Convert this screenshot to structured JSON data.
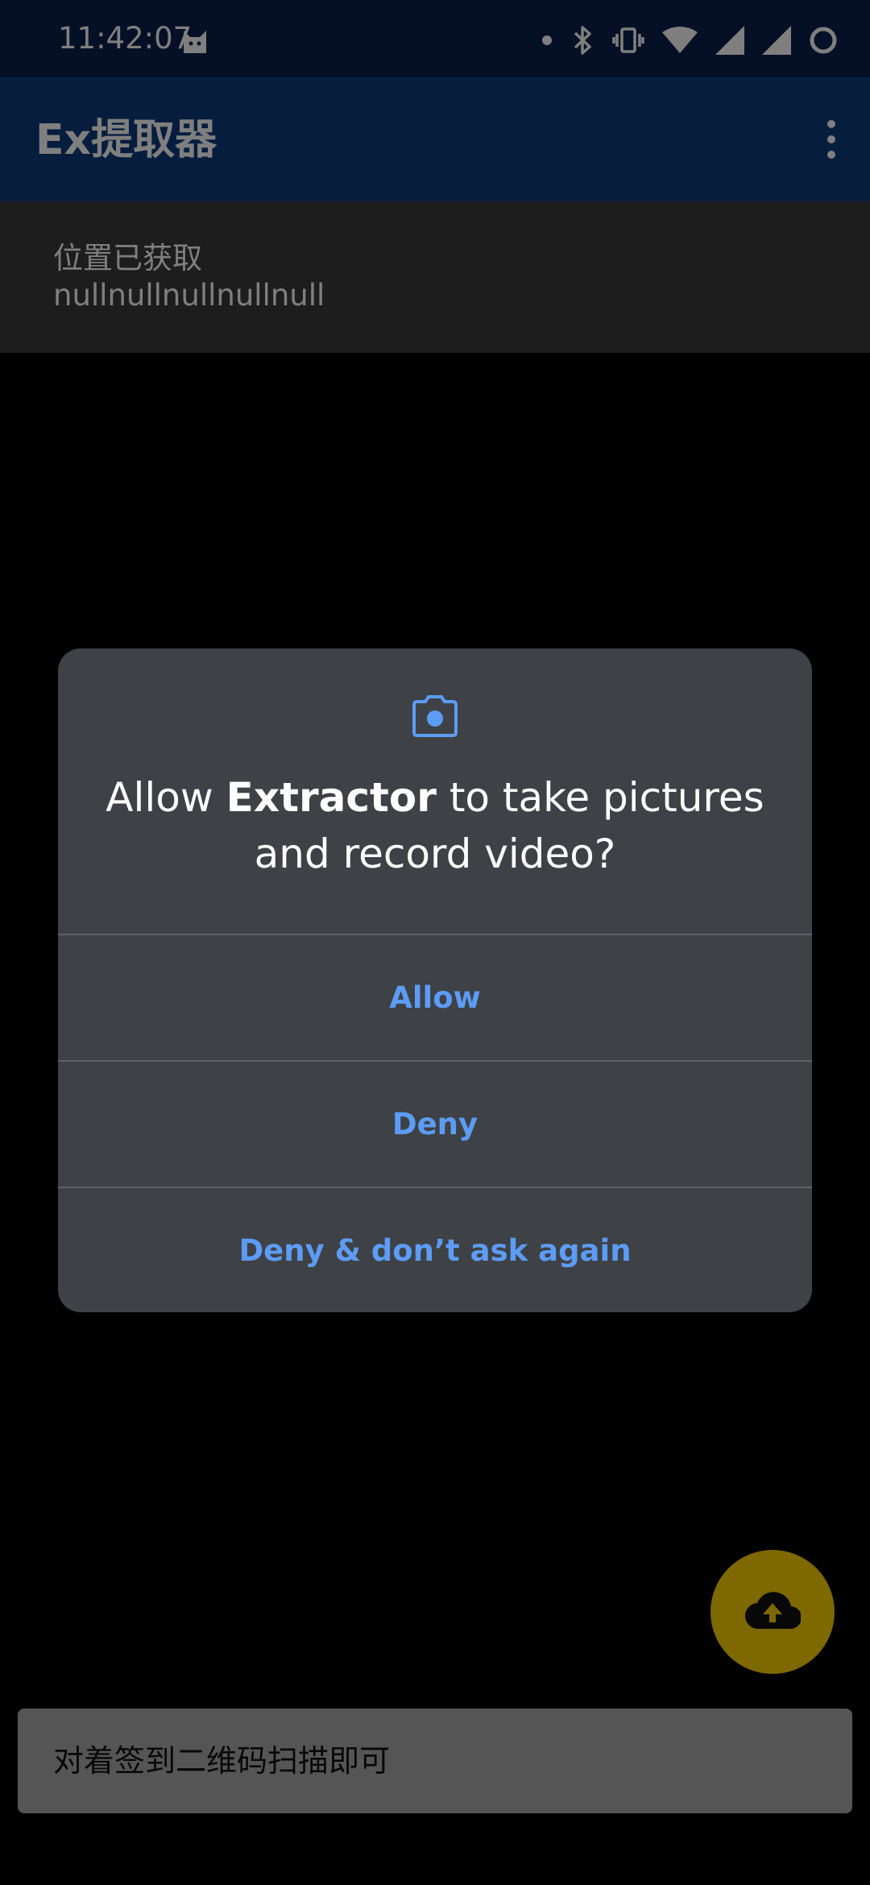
{
  "status_bar": {
    "time": "11:42:07",
    "icons": [
      "cat-icon",
      "dot-icon",
      "bluetooth-icon",
      "vibrate-icon",
      "wifi-icon",
      "signal-icon",
      "signal-icon",
      "battery-ring-icon"
    ]
  },
  "app_bar": {
    "title": "Ex提取器"
  },
  "location": {
    "title": "位置已获取",
    "value": "nullnullnullnullnull"
  },
  "fab": {
    "icon": "cloud-upload-icon"
  },
  "hint": {
    "text": "对着签到二维码扫描即可"
  },
  "dialog": {
    "icon": "camera-icon",
    "title_prefix": "Allow ",
    "app_name": "Extractor",
    "title_suffix": " to take pictures and record video?",
    "allow_label": "Allow",
    "deny_label": "Deny",
    "deny_forever_label": "Deny & don’t ask again"
  },
  "colors": {
    "status_bar_bg": "#0a1f4a",
    "app_bar_bg": "#0d3b7a",
    "dialog_bg": "#3e4145",
    "dialog_button_text": "#5c9cf5",
    "fab_bg": "#fdd000"
  }
}
